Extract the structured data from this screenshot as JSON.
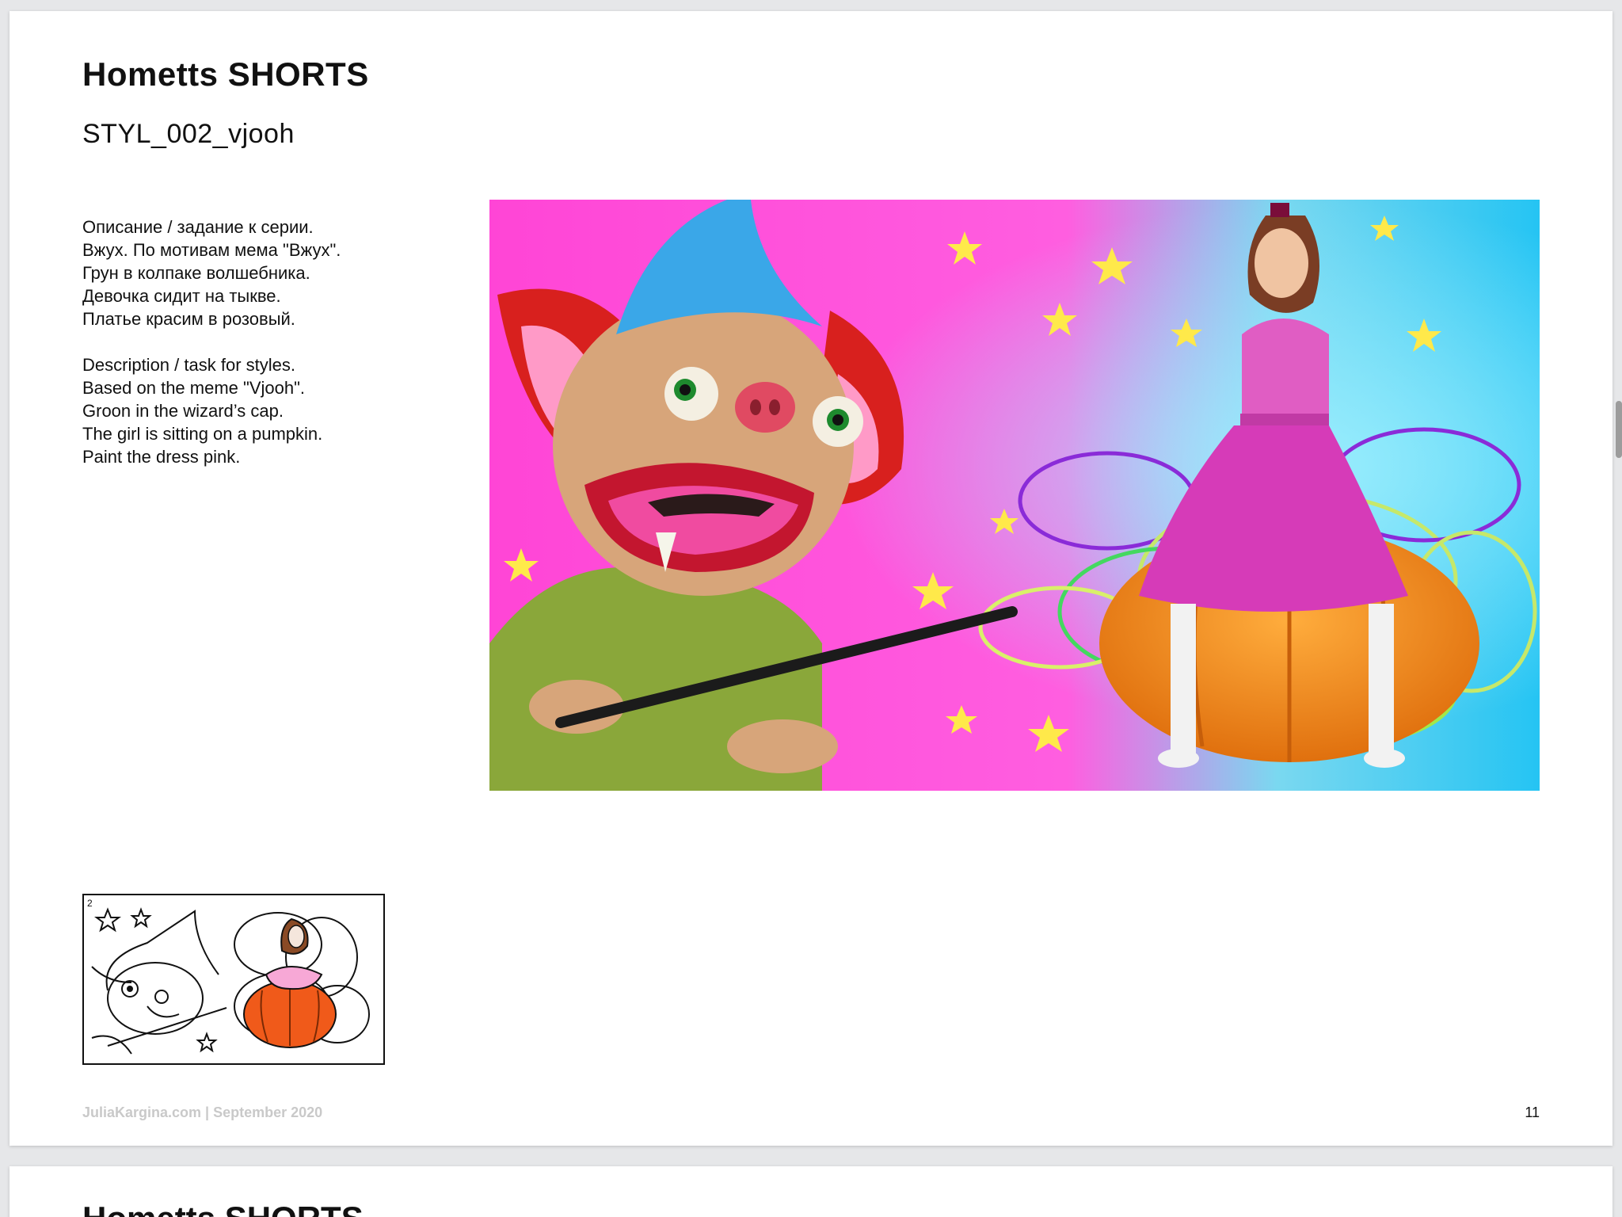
{
  "document": {
    "title": "Hometts SHORTS",
    "subtitle": "STYL_002_vjooh",
    "description_ru": [
      "Описание / задание к серии.",
      "Вжух. По мотивам мема \"Вжух\".",
      "Грун в колпаке волшебника.",
      "Девочка сидит на тыкве.",
      "Платье красим в розовый."
    ],
    "description_en": [
      "Description / task for styles.",
      "Based on the meme \"Vjooh\".",
      "Groon in the wizard’s cap.",
      "The girl is sitting on a pumpkin.",
      "Paint the dress pink."
    ],
    "footer_left": "JuliaKargina.com | September 2020",
    "page_number": "11",
    "next_page_title": "Hometts SHORTS"
  },
  "colors": {
    "background_pink": "#ff4fd8",
    "background_blue": "#2ac8f5",
    "puppet_skin": "#d7a57a",
    "puppet_ears": "#d8201e",
    "puppet_body": "#8aa73a",
    "hat_blue": "#3aa7e8",
    "dress_pink": "#d63bb8",
    "pumpkin_orange": "#f18a1f",
    "footer_gray": "#c9c9c9"
  },
  "icons": {
    "hero_image": "puppet-and-girl-illustration",
    "sketch_image": "storyboard-sketch"
  }
}
